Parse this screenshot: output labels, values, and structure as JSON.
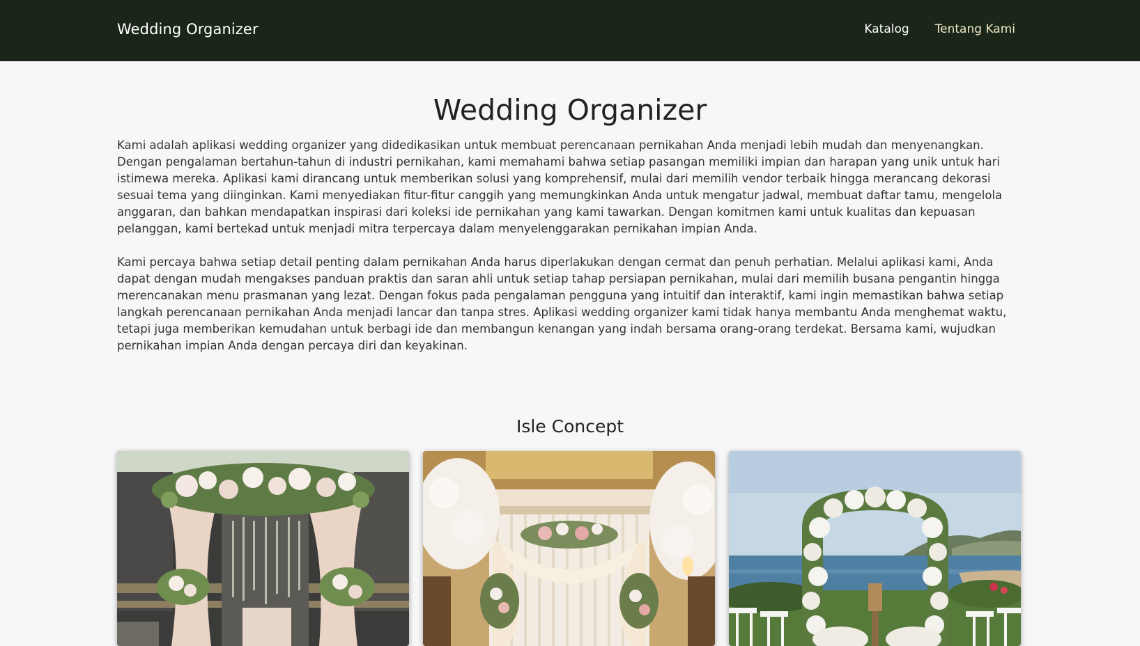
{
  "navbar": {
    "brand": "Wedding Organizer",
    "links": [
      {
        "label": "Katalog"
      },
      {
        "label": "Tentang Kami"
      }
    ]
  },
  "main": {
    "title": "Wedding Organizer",
    "paragraphs": [
      "Kami adalah aplikasi wedding organizer yang didedikasikan untuk membuat perencanaan pernikahan Anda menjadi lebih mudah dan menyenangkan. Dengan pengalaman bertahun-tahun di industri pernikahan, kami memahami bahwa setiap pasangan memiliki impian dan harapan yang unik untuk hari istimewa mereka. Aplikasi kami dirancang untuk memberikan solusi yang komprehensif, mulai dari memilih vendor terbaik hingga merancang dekorasi sesuai tema yang diinginkan. Kami menyediakan fitur-fitur canggih yang memungkinkan Anda untuk mengatur jadwal, membuat daftar tamu, mengelola anggaran, dan bahkan mendapatkan inspirasi dari koleksi ide pernikahan yang kami tawarkan. Dengan komitmen kami untuk kualitas dan kepuasan pelanggan, kami bertekad untuk menjadi mitra terpercaya dalam menyelenggarakan pernikahan impian Anda.",
      "Kami percaya bahwa setiap detail penting dalam pernikahan Anda harus diperlakukan dengan cermat dan penuh perhatian. Melalui aplikasi kami, Anda dapat dengan mudah mengakses panduan praktis dan saran ahli untuk setiap tahap persiapan pernikahan, mulai dari memilih busana pengantin hingga merencanakan menu prasmanan yang lezat. Dengan fokus pada pengalaman pengguna yang intuitif dan interaktif, kami ingin memastikan bahwa setiap langkah perencanaan pernikahan Anda menjadi lancar dan tanpa stres. Aplikasi wedding organizer kami tidak hanya membantu Anda menghemat waktu, tetapi juga memberikan kemudahan untuk berbagi ide dan membangun kenangan yang indah bersama orang-orang terdekat. Bersama kami, wujudkan pernikahan impian Anda dengan percaya diri dan keyakinan."
    ]
  },
  "concept": {
    "title": "Isle Concept",
    "cards": [
      {
        "image": "floral-drape-arch-stone-wall"
      },
      {
        "image": "indoor-white-blossom-altar"
      },
      {
        "image": "ocean-view-flower-arch"
      }
    ]
  }
}
